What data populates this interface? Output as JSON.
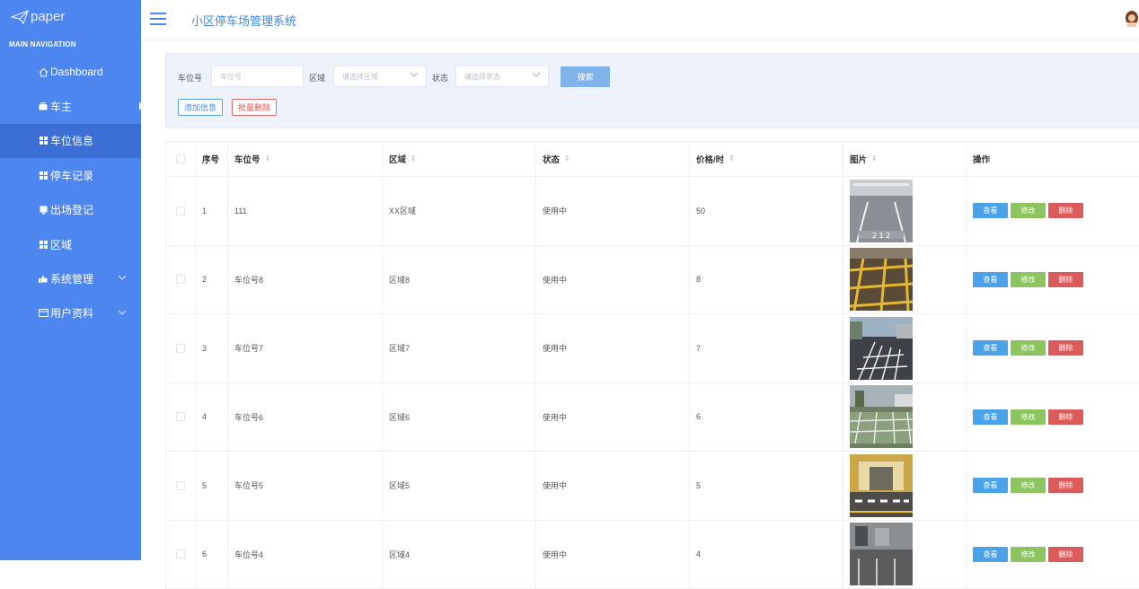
{
  "sidebar": {
    "logo": "paper",
    "heading": "MAIN NAVIGATION",
    "items": [
      {
        "label": "Dashboard",
        "icon": "home-icon"
      },
      {
        "label": "车主",
        "icon": "briefcase-icon"
      },
      {
        "label": "车位信息",
        "icon": "grid-icon"
      },
      {
        "label": "停车记录",
        "icon": "grid-icon"
      },
      {
        "label": "出场登记",
        "icon": "tablet-icon"
      },
      {
        "label": "区域",
        "icon": "grid-icon"
      },
      {
        "label": "系统管理",
        "icon": "thumbs-up-icon"
      },
      {
        "label": "用户资料",
        "icon": "id-card-icon"
      }
    ]
  },
  "header": {
    "title": "小区停车场管理系统"
  },
  "search": {
    "num_label": "车位号",
    "num_placeholder": "车位号",
    "area_label": "区域",
    "area_placeholder": "请选择区域",
    "state_label": "状态",
    "state_placeholder": "请选择状态",
    "search_button": "搜索",
    "add_button": "添加信息",
    "batch_delete_button": "批量删除"
  },
  "table": {
    "headers": {
      "no": "序号",
      "num": "车位号",
      "area": "区域",
      "state": "状态",
      "price": "价格/时",
      "img": "图片",
      "op": "操作"
    },
    "actions": {
      "view": "查看",
      "edit": "修改",
      "delete": "删除"
    },
    "rows": [
      {
        "no": "1",
        "num": "111",
        "area": "XX区域",
        "state": "使用中",
        "price": "50"
      },
      {
        "no": "2",
        "num": "车位号8",
        "area": "区域8",
        "state": "使用中",
        "price": "8"
      },
      {
        "no": "3",
        "num": "车位号7",
        "area": "区域7",
        "state": "使用中",
        "price": "7"
      },
      {
        "no": "4",
        "num": "车位号6",
        "area": "区域6",
        "state": "使用中",
        "price": "6"
      },
      {
        "no": "5",
        "num": "车位号5",
        "area": "区域5",
        "state": "使用中",
        "price": "5"
      },
      {
        "no": "6",
        "num": "车位号4",
        "area": "区域4",
        "state": "使用中",
        "price": "4"
      }
    ]
  },
  "colors": {
    "sidebar": "#4e86f0",
    "sidebar_active": "#3c6fd6",
    "primary": "#3f86e0",
    "view": "#4aa3e8",
    "edit": "#8cc45f",
    "delete": "#db5b5b"
  }
}
